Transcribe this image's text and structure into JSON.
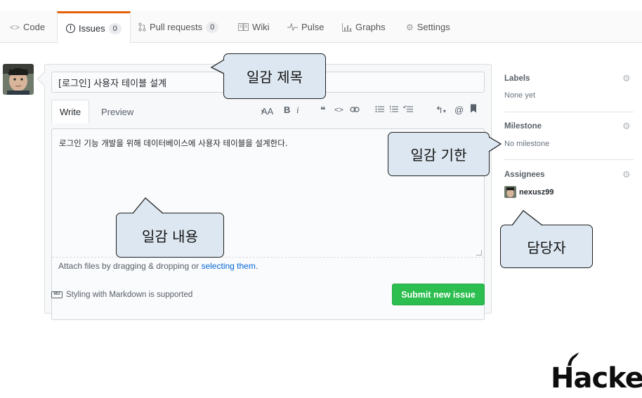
{
  "tabs": [
    {
      "label": "Code",
      "icon": "code-icon"
    },
    {
      "label": "Issues",
      "icon": "issue-opened-icon",
      "count": "0",
      "active": true
    },
    {
      "label": "Pull requests",
      "icon": "git-pull-request-icon",
      "count": "0"
    },
    {
      "label": "Wiki",
      "icon": "book-icon"
    },
    {
      "label": "Pulse",
      "icon": "pulse-icon"
    },
    {
      "label": "Graphs",
      "icon": "graph-icon"
    },
    {
      "label": "Settings",
      "icon": "gear-icon"
    }
  ],
  "issue_form": {
    "title_value": "[로그인] 사용자 테이블 설계",
    "tab_write": "Write",
    "tab_preview": "Preview",
    "toolbar": {
      "header": "AA",
      "bold": "B",
      "italic": "i",
      "quote": "❝",
      "code": "<>",
      "link": "⊘",
      "ul": "☰",
      "ol": "☰",
      "task": "☰",
      "reply": "↰",
      "mention": "@",
      "bookmark": "▮"
    },
    "body_value": "로그인 기능 개발을 위해 데이터베이스에 사용자 테이블을 설계한다.",
    "attach_text": "Attach files by dragging & dropping or ",
    "attach_link": "selecting them",
    "attach_end": ".",
    "markdown_note": "Styling with Markdown is supported",
    "markdown_badge": "MD",
    "submit_label": "Submit new issue"
  },
  "sidebar": {
    "labels": {
      "heading": "Labels",
      "value": "None yet"
    },
    "milestone": {
      "heading": "Milestone",
      "value": "No milestone"
    },
    "assignees": {
      "heading": "Assignees",
      "user": "nexusz99"
    }
  },
  "callouts": {
    "title": "일감 제목",
    "deadline": "일감 기한",
    "content": "일감 내용",
    "assignee": "담당자"
  },
  "logo": {
    "text": "Hacker"
  },
  "colors": {
    "active_tab_accent": "#e36209",
    "submit_green": "#2cbe4e",
    "link_blue": "#0366d6",
    "callout_fill": "#dde7f1"
  }
}
